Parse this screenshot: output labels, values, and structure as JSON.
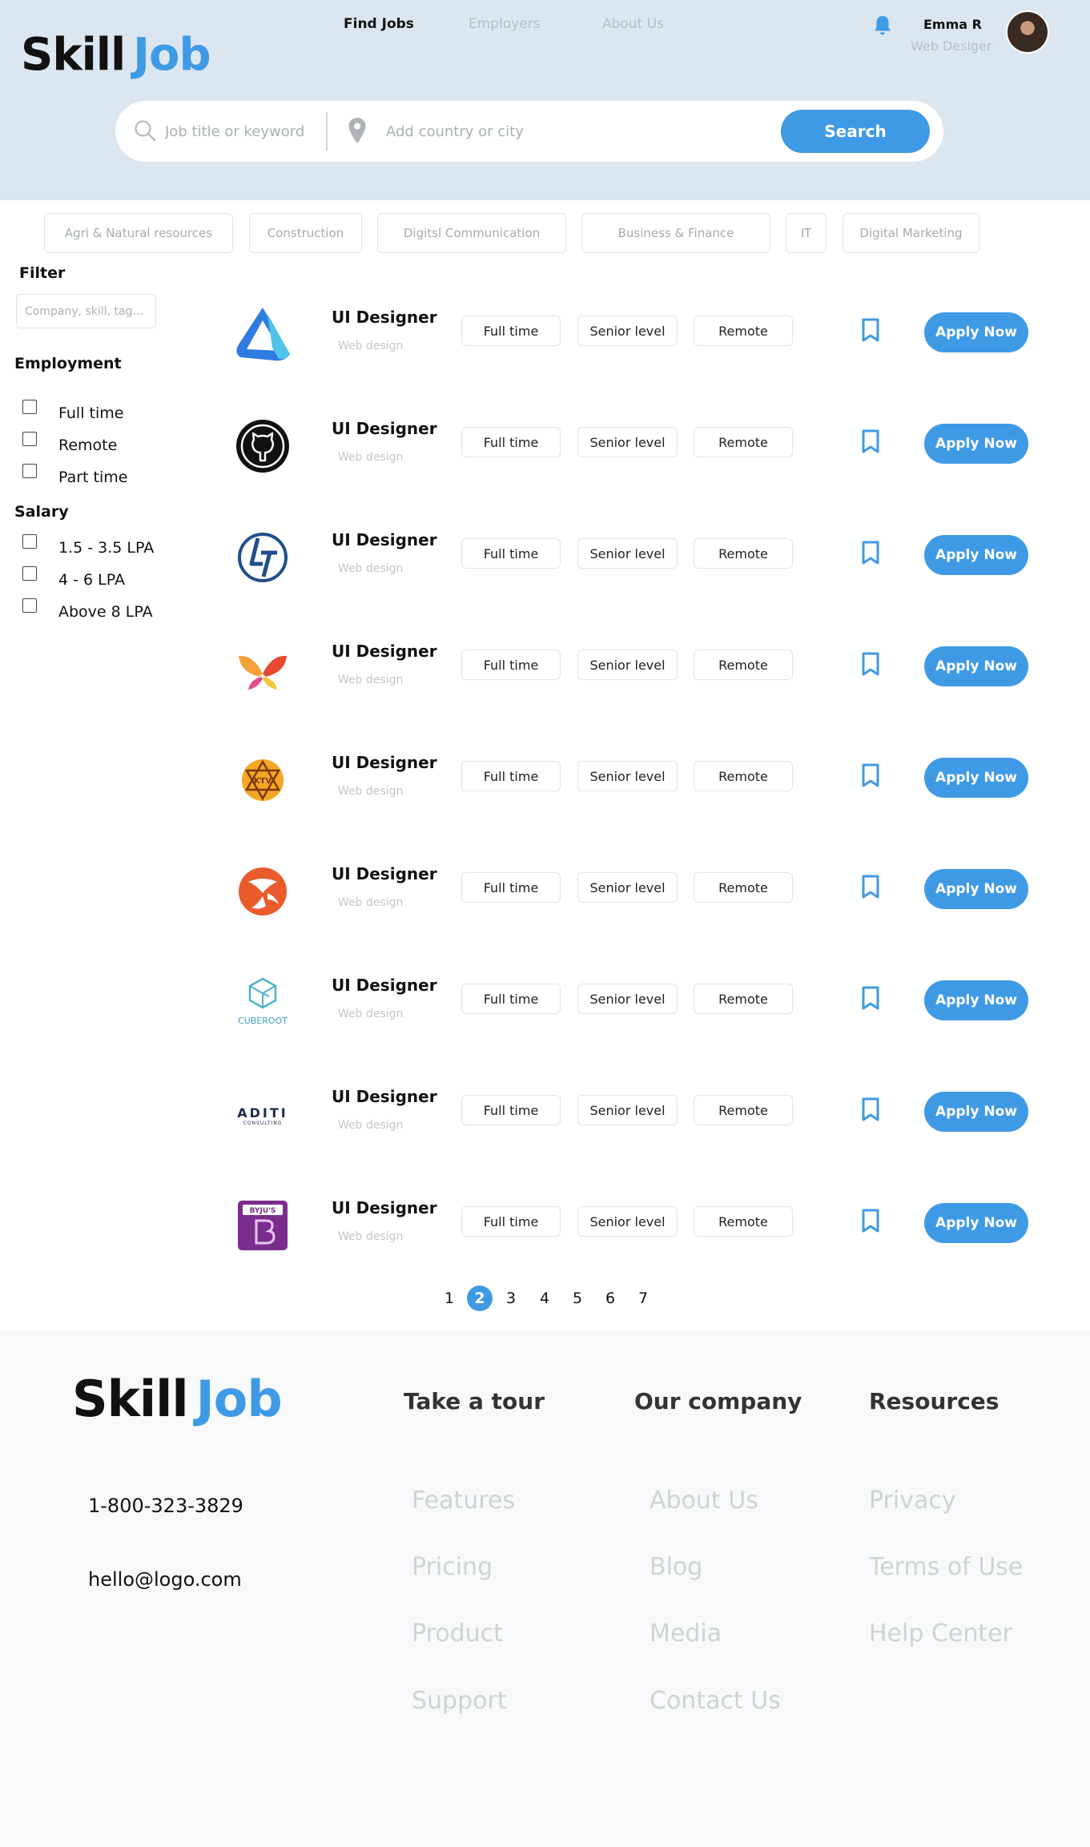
{
  "brand": {
    "part1": "Skill",
    "part2": "Job"
  },
  "nav": [
    {
      "label": "Find Jobs",
      "active": true
    },
    {
      "label": "Employers",
      "active": false
    },
    {
      "label": "About Us",
      "active": false
    }
  ],
  "user": {
    "name": "Emma R",
    "role": "Web Desiger"
  },
  "search": {
    "keyword_placeholder": "Job title or keyword",
    "location_placeholder": "Add country or city",
    "button": "Search"
  },
  "categories": [
    "Agri & Natural resources",
    "Construction",
    "Digitsl Communication",
    "Business & Finance",
    "IT",
    "Digital Marketing"
  ],
  "filter": {
    "title": "Filter",
    "placeholder": "Company, skill, tag...",
    "employment_title": "Employment",
    "employment": [
      "Full time",
      "Remote",
      "Part time"
    ],
    "salary_title": "Salary",
    "salary": [
      "1.5 - 3.5 LPA",
      "4 - 6 LPA",
      "Above 8 LPA"
    ]
  },
  "jobs": [
    {
      "title": "UI Designer",
      "subtitle": "Web design",
      "tags": [
        "Full time",
        "Senior level",
        "Remote"
      ],
      "apply": "Apply Now",
      "logo": "triangle-logo-icon"
    },
    {
      "title": "UI Designer",
      "subtitle": "Web design",
      "tags": [
        "Full time",
        "Senior level",
        "Remote"
      ],
      "apply": "Apply Now",
      "logo": "github-logo-icon"
    },
    {
      "title": "UI Designer",
      "subtitle": "Web design",
      "tags": [
        "Full time",
        "Senior level",
        "Remote"
      ],
      "apply": "Apply Now",
      "logo": "lt-logo-icon"
    },
    {
      "title": "UI Designer",
      "subtitle": "Web design",
      "tags": [
        "Full time",
        "Senior level",
        "Remote"
      ],
      "apply": "Apply Now",
      "logo": "butterfly-logo-icon"
    },
    {
      "title": "UI Designer",
      "subtitle": "Web design",
      "tags": [
        "Full time",
        "Senior level",
        "Remote"
      ],
      "apply": "Apply Now",
      "logo": "ktv-logo-icon"
    },
    {
      "title": "UI Designer",
      "subtitle": "Web design",
      "tags": [
        "Full time",
        "Senior level",
        "Remote"
      ],
      "apply": "Apply Now",
      "logo": "swirl-logo-icon"
    },
    {
      "title": "UI Designer",
      "subtitle": "Web design",
      "tags": [
        "Full time",
        "Senior level",
        "Remote"
      ],
      "apply": "Apply Now",
      "logo": "cuberoot-logo-icon",
      "logo_text": "CUBEROOT"
    },
    {
      "title": "UI Designer",
      "subtitle": "Web design",
      "tags": [
        "Full time",
        "Senior level",
        "Remote"
      ],
      "apply": "Apply Now",
      "logo": "aditi-logo-icon",
      "logo_text": "ADITI",
      "logo_subtext": "CONSULTING"
    },
    {
      "title": "UI Designer",
      "subtitle": "Web design",
      "tags": [
        "Full time",
        "Senior level",
        "Remote"
      ],
      "apply": "Apply Now",
      "logo": "byjus-logo-icon",
      "logo_text": "BYJU'S"
    }
  ],
  "pagination": {
    "pages": [
      "1",
      "2",
      "3",
      "4",
      "5",
      "6",
      "7"
    ],
    "current": "2"
  },
  "footer": {
    "phone": "1-800-323-3829",
    "email": "hello@logo.com",
    "columns": [
      {
        "heading": "Take a tour",
        "links": [
          "Features",
          "Pricing",
          "Product",
          "Support"
        ]
      },
      {
        "heading": "Our company",
        "links": [
          "About Us",
          "Blog",
          "Media",
          "Contact Us"
        ]
      },
      {
        "heading": "Resources",
        "links": [
          "Privacy",
          "Terms of Use",
          "Help Center"
        ]
      }
    ]
  },
  "colors": {
    "accent": "#3f9ae6",
    "header_bg": "#dbe6f1",
    "footer_bg": "#f8f9fb"
  }
}
